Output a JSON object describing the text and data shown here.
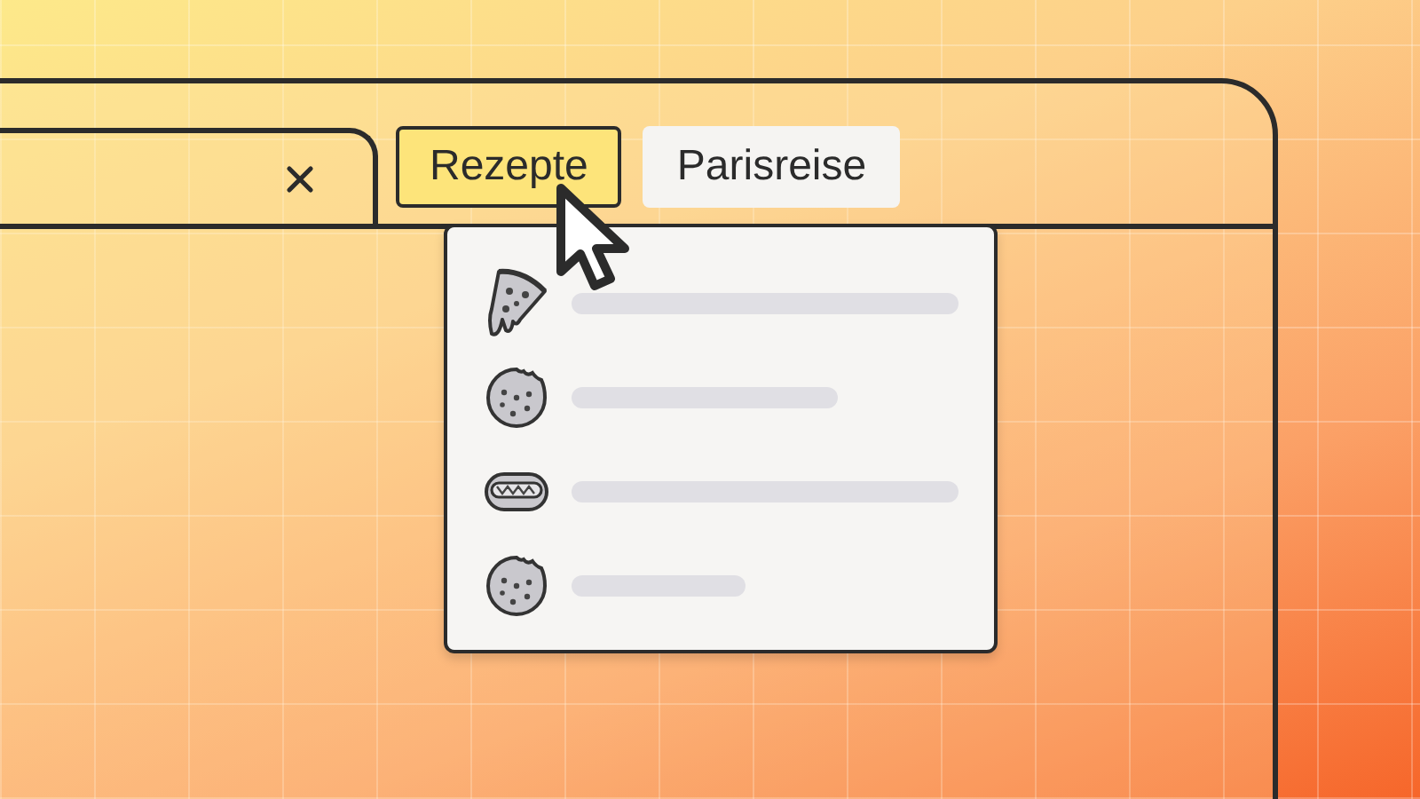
{
  "tabs": [
    {
      "kind": "plain"
    },
    {
      "kind": "group",
      "label": "Rezepte",
      "selected": true
    },
    {
      "kind": "group",
      "label": "Parisreise",
      "selected": false
    }
  ],
  "menu": {
    "items": [
      {
        "kind": "pizza"
      },
      {
        "kind": "cookie"
      },
      {
        "kind": "hotdog"
      },
      {
        "kind": "cookie"
      }
    ]
  }
}
